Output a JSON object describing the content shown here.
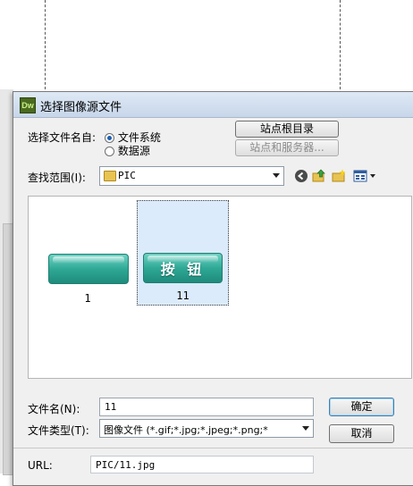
{
  "dialog": {
    "app_icon": "Dw",
    "title": "选择图像源文件"
  },
  "source": {
    "label": "选择文件名自:",
    "options": [
      "文件系统",
      "数据源"
    ],
    "selected": "文件系统"
  },
  "buttons": {
    "site_root": "站点根目录",
    "site_server": "站点和服务器...",
    "ok": "确定",
    "cancel": "取消"
  },
  "lookin": {
    "label": "查找范围(I):",
    "value": "PIC",
    "icons": [
      "back-icon",
      "up-folder-icon",
      "new-folder-icon",
      "view-menu-icon"
    ]
  },
  "files": [
    {
      "name": "1",
      "thumb_text": "",
      "selected": false
    },
    {
      "name": "11",
      "thumb_text": "按 钮",
      "selected": true
    }
  ],
  "filename": {
    "label": "文件名(N):",
    "value": "11"
  },
  "filetype": {
    "label": "文件类型(T):",
    "value": "图像文件 (*.gif;*.jpg;*.jpeg;*.png;*"
  },
  "url": {
    "label": "URL:",
    "value": "PIC/11.jpg"
  },
  "colors": {
    "accent": "#3c7fb1",
    "thumb_teal": "#2fa996",
    "selection": "#dcebfc"
  }
}
